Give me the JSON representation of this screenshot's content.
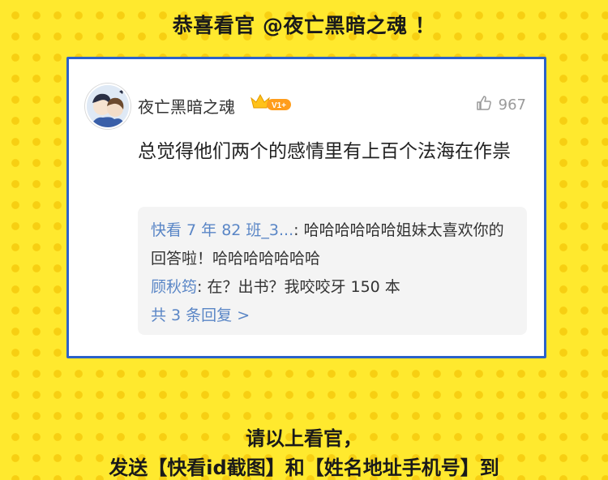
{
  "header": {
    "title": "恭喜看官 @夜亡黑暗之魂 ！"
  },
  "comment": {
    "username": "夜亡黑暗之魂",
    "badge_level": "V1+",
    "likes": "967",
    "text": "总觉得他们两个的感情里有上百个法海在作祟"
  },
  "replies": {
    "items": [
      {
        "author": "快看 7 年 82 班_3...",
        "text": ": 哈哈哈哈哈哈姐妹太喜欢你的回答啦！哈哈哈哈哈哈哈"
      },
      {
        "author": "顾秋筠",
        "text": ": 在？出书？我咬咬牙 150 本"
      }
    ],
    "more_label": "共 3 条回复 >"
  },
  "footer": {
    "line1": "请以上看官，",
    "line2": "发送【快看id截图】和【姓名地址手机号】到"
  },
  "colors": {
    "background": "#ffe92e",
    "dots": "#f7cf12",
    "card_border": "#2b62c9",
    "reply_author": "#5a86c6"
  },
  "icons": {
    "like": "thumbs-up-icon",
    "crown": "crown-icon"
  }
}
